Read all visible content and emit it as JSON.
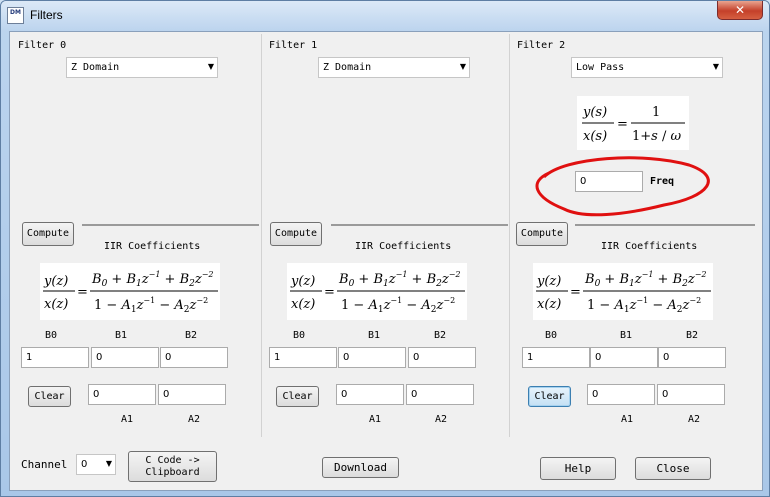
{
  "window": {
    "title": "Filters",
    "close_glyph": "✕",
    "app_icon_text": "DM"
  },
  "panels": [
    {
      "title": "Filter 0",
      "type": "Z Domain",
      "compute_label": "Compute",
      "iir_label": "IIR Coefficients",
      "b_labels": [
        "B0",
        "B1",
        "B2"
      ],
      "b_values": [
        "1",
        "0",
        "0"
      ],
      "a_labels": [
        "A1",
        "A2"
      ],
      "a_values": [
        "0",
        "0"
      ],
      "clear_label": "Clear"
    },
    {
      "title": "Filter 1",
      "type": "Z Domain",
      "compute_label": "Compute",
      "iir_label": "IIR Coefficients",
      "b_labels": [
        "B0",
        "B1",
        "B2"
      ],
      "b_values": [
        "1",
        "0",
        "0"
      ],
      "a_labels": [
        "A1",
        "A2"
      ],
      "a_values": [
        "0",
        "0"
      ],
      "clear_label": "Clear"
    },
    {
      "title": "Filter 2",
      "type": "Low Pass",
      "compute_label": "Compute",
      "iir_label": "IIR Coefficients",
      "freq_value": "0",
      "freq_label": "Freq",
      "b_labels": [
        "B0",
        "B1",
        "B2"
      ],
      "b_values": [
        "1",
        "0",
        "0"
      ],
      "a_labels": [
        "A1",
        "A2"
      ],
      "a_values": [
        "0",
        "0"
      ],
      "clear_label": "Clear"
    }
  ],
  "bottom": {
    "channel_label": "Channel",
    "channel_value": "0",
    "ccode_line1": "C Code ->",
    "ccode_line2": "Clipboard",
    "download_label": "Download",
    "help_label": "Help",
    "close_label": "Close"
  },
  "colors": {
    "annotation_red": "#e01010",
    "titlebar_close": "#c4402a"
  }
}
